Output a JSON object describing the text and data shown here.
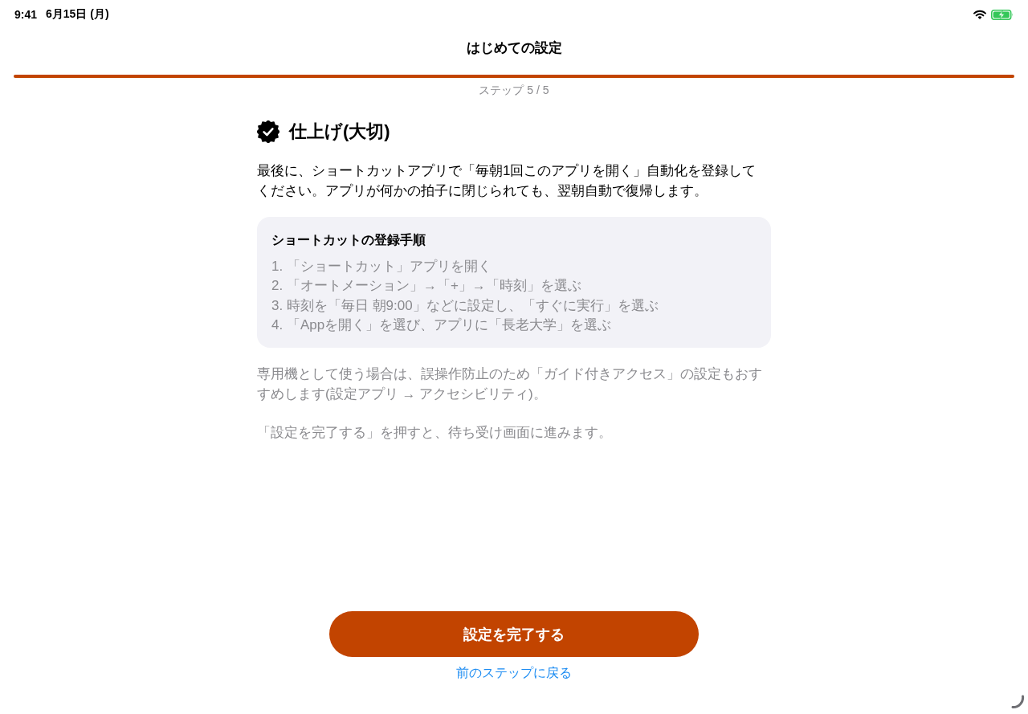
{
  "status_bar": {
    "time": "9:41",
    "date": "6月15日 (月)"
  },
  "nav": {
    "title": "はじめての設定"
  },
  "progress": {
    "level": 1,
    "label": "ステップ 5 / 5"
  },
  "section": {
    "title": "仕上げ(大切)",
    "body": "最後に、ショートカットアプリで「毎朝1回このアプリを開く」自動化を登録してください。アプリが何かの拍子に閉じられても、翌朝自動で復帰します。"
  },
  "card": {
    "title": "ショートカットの登録手順",
    "steps": [
      "1. 「ショートカット」アプリを開く",
      "2. 「オートメーション」→「+」→「時刻」を選ぶ",
      "3. 時刻を「毎日 朝9:00」などに設定し、「すぐに実行」を選ぶ",
      "4. 「Appを開く」を選び、アプリに「長老大学」を選ぶ"
    ]
  },
  "notes": [
    "専用機として使う場合は、誤操作防止のため「ガイド付きアクセス」の設定もおすすめします(設定アプリ → アクセシビリティ)。",
    "「設定を完了する」を押すと、待ち受け画面に進みます。"
  ],
  "primary_button": "設定を完了する",
  "back_link": "前のステップに戻る"
}
